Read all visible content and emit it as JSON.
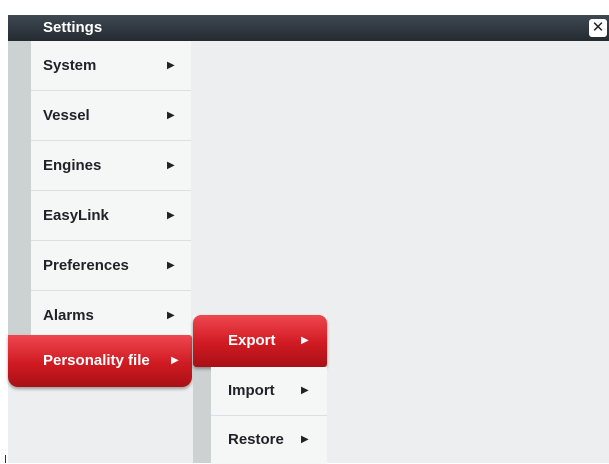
{
  "window": {
    "title": "Settings",
    "close_icon": "✕"
  },
  "menu": {
    "items": [
      {
        "label": "System",
        "arrow": "▶"
      },
      {
        "label": "Vessel",
        "arrow": "▶"
      },
      {
        "label": "Engines",
        "arrow": "▶"
      },
      {
        "label": "EasyLink",
        "arrow": "▶"
      },
      {
        "label": "Preferences",
        "arrow": "▶"
      },
      {
        "label": "Alarms",
        "arrow": "▶"
      }
    ],
    "selected": {
      "label": "Personality file",
      "arrow": "▶"
    }
  },
  "submenu": {
    "selected": {
      "label": "Export",
      "arrow": "▶"
    },
    "items": [
      {
        "label": "Import",
        "arrow": "▶"
      },
      {
        "label": "Restore",
        "arrow": "▶"
      }
    ]
  },
  "colors": {
    "title_bar": "#2d353d",
    "selected_red": "#d01a22",
    "menu_bg": "#f5f6f6",
    "panel_bg": "#eceeef",
    "strip": "#ccd1d1"
  }
}
